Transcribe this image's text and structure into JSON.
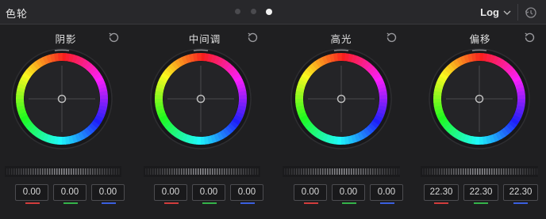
{
  "header": {
    "title": "色轮",
    "page_dots": 3,
    "active_dot": 2,
    "mode": "Log",
    "reset_icon": "reset-all-icon"
  },
  "channel_colors": {
    "red": "#d23c3c",
    "green": "#34b34a",
    "blue": "#3a5fe0"
  },
  "wheels": [
    {
      "label": "阴影",
      "values": [
        "0.00",
        "0.00",
        "0.00"
      ]
    },
    {
      "label": "中间调",
      "values": [
        "0.00",
        "0.00",
        "0.00"
      ]
    },
    {
      "label": "高光",
      "values": [
        "0.00",
        "0.00",
        "0.00"
      ]
    },
    {
      "label": "偏移",
      "values": [
        "22.30",
        "22.30",
        "22.30"
      ]
    }
  ]
}
